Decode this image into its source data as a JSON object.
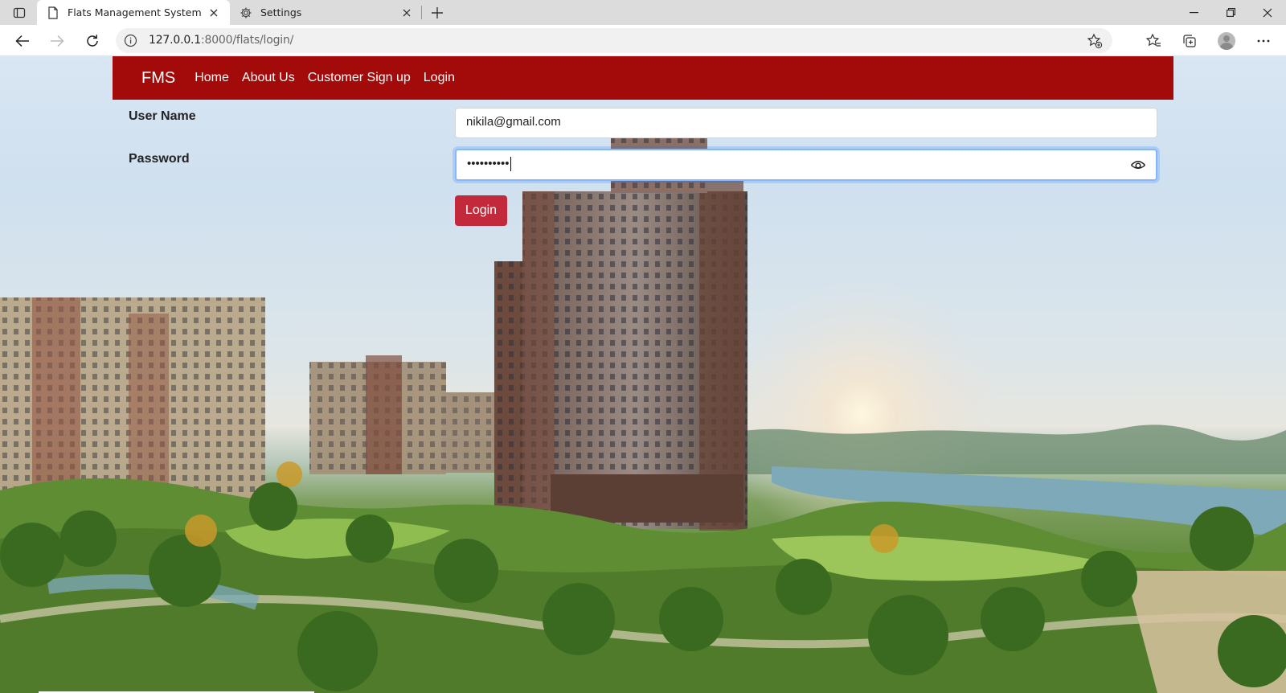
{
  "browser": {
    "tabs": [
      {
        "title": "Flats Management System",
        "active": true,
        "icon": "page-icon"
      },
      {
        "title": "Settings",
        "active": false,
        "icon": "gear-icon"
      }
    ],
    "address": {
      "host": "127.0.0.1",
      "path": ":8000/flats/login/"
    }
  },
  "nav": {
    "brand": "FMS",
    "links": [
      "Home",
      "About Us",
      "Customer Sign up",
      "Login"
    ]
  },
  "form": {
    "username_label": "User Name",
    "username_value": "nikila@gmail.com",
    "password_label": "Password",
    "password_value": "••••••••••",
    "submit_label": "Login"
  },
  "colors": {
    "navbar": "#a30b0b",
    "button": "#c22a3c",
    "focus_ring": "#86b7fe"
  }
}
